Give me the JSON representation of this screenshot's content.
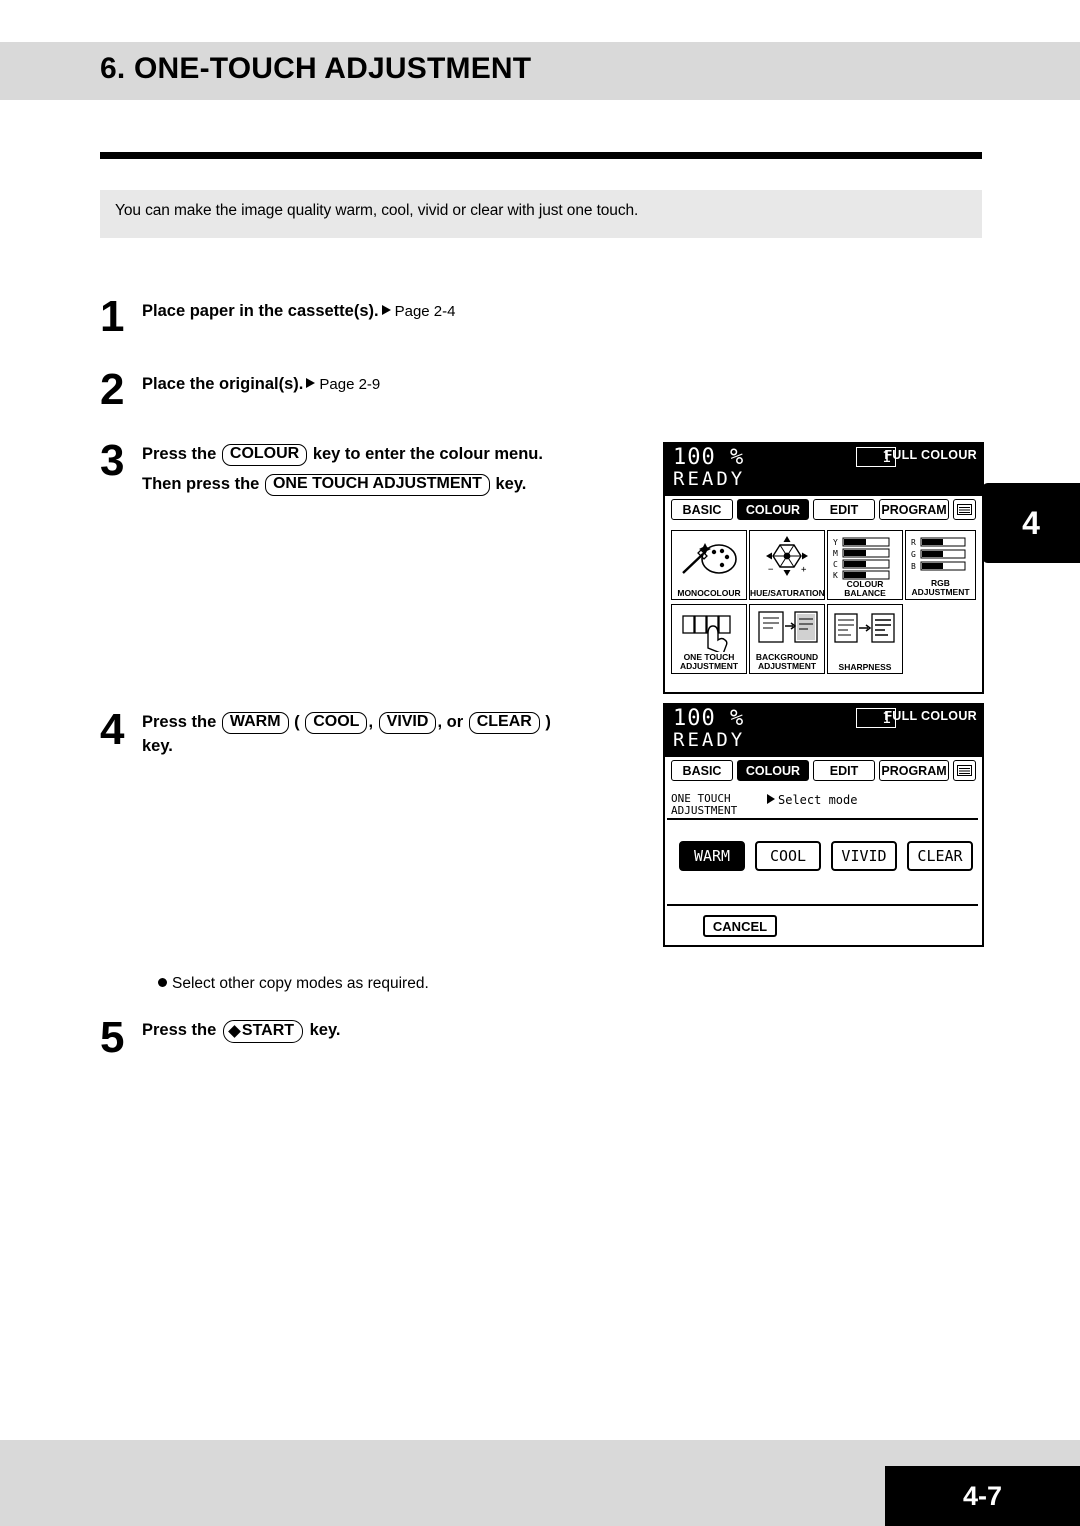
{
  "header": {
    "title": "6. ONE-TOUCH ADJUSTMENT"
  },
  "intro": {
    "text": "You can make the image quality warm, cool, vivid  or clear with just one touch."
  },
  "steps": [
    {
      "num": "1",
      "text": "Place paper in the cassette(s).",
      "page_ref": "Page 2-4"
    },
    {
      "num": "2",
      "text": "Place the original(s).",
      "page_ref": "Page 2-9"
    },
    {
      "num": "3",
      "line1_pre": "Press the",
      "line1_key": "COLOUR",
      "line1_post": "key to enter the colour menu.",
      "line2_pre": "Then press the",
      "line2_key": "ONE  TOUCH ADJUSTMENT",
      "line2_post": "key."
    },
    {
      "num": "4",
      "pre": "Press the",
      "key1": "WARM",
      "paren_open": "(",
      "key2": "COOL",
      "comma1": ",",
      "key3": "VIVID",
      "comma2": ",",
      "or": "or",
      "key4": "CLEAR",
      "paren_close": ")",
      "post": "key."
    },
    {
      "num": "5",
      "pre": "Press the",
      "key": "START",
      "post": "key."
    }
  ],
  "note": {
    "text": "Select other copy modes as required."
  },
  "side_tab": {
    "label": "4"
  },
  "footer": {
    "page": "4-7"
  },
  "panel1": {
    "zoom": "100 %",
    "ready": "READY",
    "copies": "1",
    "colour_mode": "FULL COLOUR",
    "tabs": [
      {
        "label": "BASIC",
        "active": false
      },
      {
        "label": "COLOUR",
        "active": true
      },
      {
        "label": "EDIT",
        "active": false
      },
      {
        "label": "PROGRAM",
        "active": false
      },
      {
        "label": "",
        "active": false
      }
    ],
    "tiles": [
      {
        "label": "MONOCOLOUR"
      },
      {
        "label": "HUE/SATURATION"
      },
      {
        "label": "COLOUR BALANCE"
      },
      {
        "label": "RGB\nADJUSTMENT"
      },
      {
        "label": "ONE TOUCH\nADJUSTMENT"
      },
      {
        "label": "BACKGROUND\nADJUSTMENT"
      },
      {
        "label": "SHARPNESS"
      }
    ],
    "colour_balance_rows": [
      "Y",
      "M",
      "C",
      "K"
    ],
    "rgb_rows": [
      "R",
      "G",
      "B"
    ]
  },
  "panel2": {
    "zoom": "100 %",
    "ready": "READY",
    "copies": "1",
    "colour_mode": "FULL COLOUR",
    "tabs": [
      {
        "label": "BASIC",
        "active": false
      },
      {
        "label": "COLOUR",
        "active": true
      },
      {
        "label": "EDIT",
        "active": false
      },
      {
        "label": "PROGRAM",
        "active": false
      },
      {
        "label": "",
        "active": false
      }
    ],
    "mode_title_line1": "ONE TOUCH",
    "mode_title_line2": "ADJUSTMENT",
    "select_mode": "Select mode",
    "buttons": [
      {
        "label": "WARM",
        "selected": true
      },
      {
        "label": "COOL",
        "selected": false
      },
      {
        "label": "VIVID",
        "selected": false
      },
      {
        "label": "CLEAR",
        "selected": false
      }
    ],
    "cancel": "CANCEL"
  }
}
